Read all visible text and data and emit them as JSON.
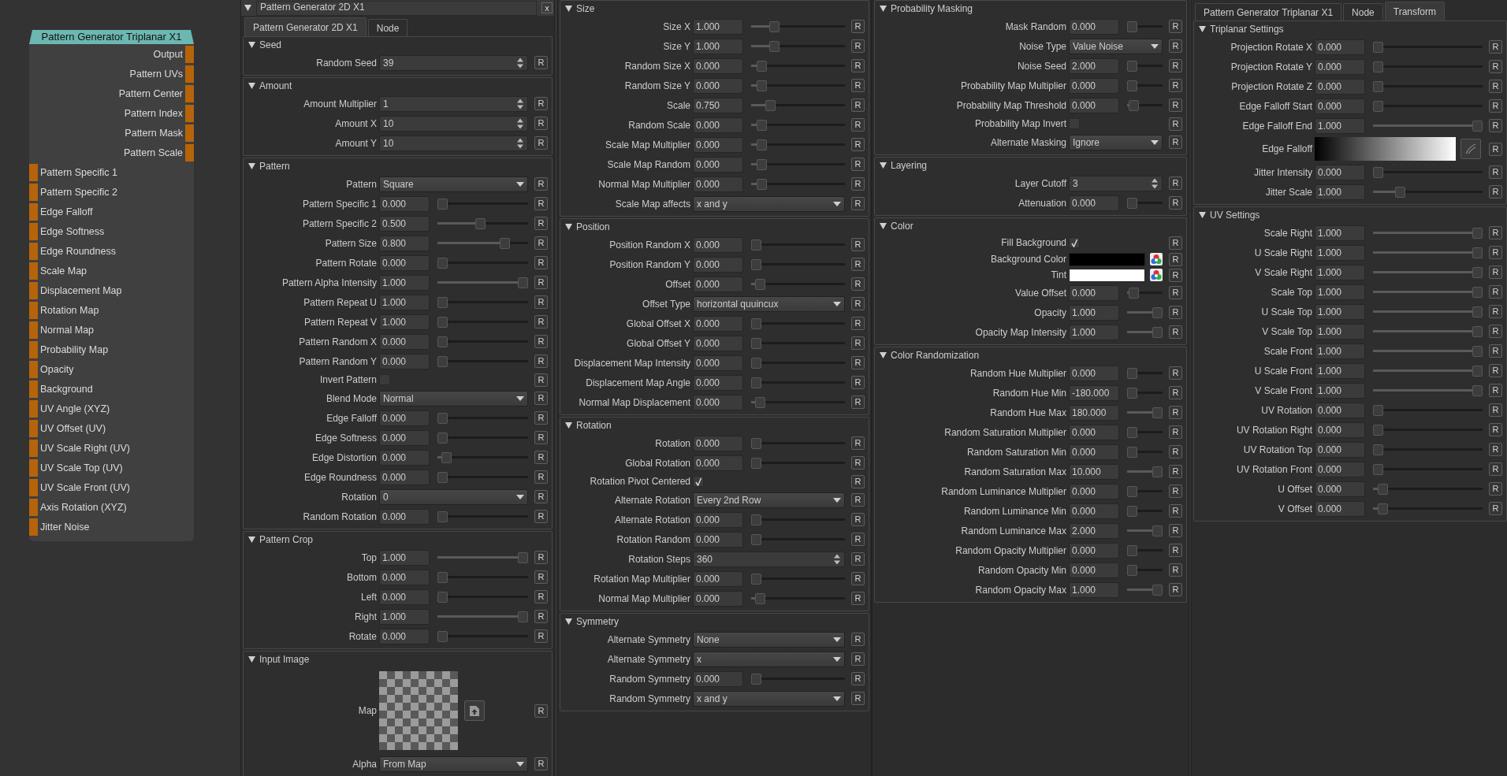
{
  "node": {
    "title": "Pattern Generator Triplanar X1",
    "outputs": [
      "Output",
      "Pattern UVs",
      "Pattern Center",
      "Pattern Index",
      "Pattern Mask",
      "Pattern Scale"
    ],
    "inputs": [
      "Pattern Specific 1",
      "Pattern Specific 2",
      "Edge Falloff",
      "Edge Softness",
      "Edge Roundness",
      "Scale Map",
      "Displacement Map",
      "Rotation Map",
      "Normal Map",
      "Probability Map",
      "Opacity",
      "Background",
      "UV Angle (XYZ)",
      "UV Offset (UV)",
      "UV Scale Right (UV)",
      "UV Scale Top (UV)",
      "UV Scale Front (UV)",
      "Axis Rotation (XYZ)",
      "Jitter Noise"
    ]
  },
  "panels": [
    {
      "header": {
        "title": "Pattern Generator 2D X1",
        "close": "x"
      },
      "tabs": [
        {
          "label": "Pattern Generator 2D X1",
          "selected": true
        },
        {
          "label": "Node",
          "selected": false
        }
      ],
      "sections": [
        {
          "title": "Seed",
          "rows": [
            {
              "kind": "spin",
              "label": "Random Seed",
              "value": "39",
              "reset": "R"
            }
          ]
        },
        {
          "title": "Amount",
          "rows": [
            {
              "kind": "spin",
              "label": "Amount Multiplier",
              "value": "1",
              "reset": "R"
            },
            {
              "kind": "spin",
              "label": "Amount X",
              "value": "10",
              "reset": "R"
            },
            {
              "kind": "spin",
              "label": "Amount Y",
              "value": "10",
              "reset": "R"
            }
          ]
        },
        {
          "title": "Pattern",
          "rows": [
            {
              "kind": "dropdown",
              "label": "Pattern",
              "value": "Square",
              "reset": "R"
            },
            {
              "kind": "slider",
              "label": "Pattern Specific 1",
              "value": "0.000",
              "level": 0,
              "reset": "R"
            },
            {
              "kind": "slider",
              "label": "Pattern Specific 2",
              "value": "0.500",
              "level": 0.47,
              "reset": "R"
            },
            {
              "kind": "slider",
              "label": "Pattern Size",
              "value": "0.800",
              "level": 0.77,
              "reset": "R"
            },
            {
              "kind": "slider",
              "label": "Pattern Rotate",
              "value": "0.000",
              "level": 0,
              "reset": "R"
            },
            {
              "kind": "slider",
              "label": "Pattern Alpha Intensity",
              "value": "1.000",
              "level": 1,
              "reset": "R"
            },
            {
              "kind": "slider",
              "label": "Pattern Repeat U",
              "value": "1.000",
              "level": 0,
              "reset": "R"
            },
            {
              "kind": "slider",
              "label": "Pattern Repeat V",
              "value": "1.000",
              "level": 0,
              "reset": "R"
            },
            {
              "kind": "slider",
              "label": "Pattern Random X",
              "value": "0.000",
              "level": 0,
              "reset": "R"
            },
            {
              "kind": "slider",
              "label": "Pattern Random Y",
              "value": "0.000",
              "level": 0,
              "reset": "R"
            },
            {
              "kind": "checkbox",
              "label": "Invert Pattern",
              "checked": false,
              "reset": "R"
            },
            {
              "kind": "dropdown",
              "label": "Blend Mode",
              "value": "Normal",
              "reset": "R"
            },
            {
              "kind": "slider",
              "label": "Edge Falloff",
              "value": "0.000",
              "level": 0,
              "reset": "R"
            },
            {
              "kind": "slider",
              "label": "Edge Softness",
              "value": "0.000",
              "level": 0,
              "reset": "R"
            },
            {
              "kind": "slider",
              "label": "Edge Distortion",
              "value": "0.000",
              "level": 0.05,
              "reset": "R"
            },
            {
              "kind": "slider",
              "label": "Edge Roundness",
              "value": "0.000",
              "level": 0,
              "reset": "R"
            },
            {
              "kind": "dropdown",
              "label": "Rotation",
              "value": "0",
              "reset": "R"
            },
            {
              "kind": "slider",
              "label": "Random Rotation",
              "value": "0.000",
              "level": 0,
              "reset": "R"
            }
          ]
        },
        {
          "title": "Pattern Crop",
          "rows": [
            {
              "kind": "slider",
              "label": "Top",
              "value": "1.000",
              "level": 1,
              "reset": "R"
            },
            {
              "kind": "slider",
              "label": "Bottom",
              "value": "0.000",
              "level": 0,
              "reset": "R"
            },
            {
              "kind": "slider",
              "label": "Left",
              "value": "0.000",
              "level": 0,
              "reset": "R"
            },
            {
              "kind": "slider",
              "label": "Right",
              "value": "1.000",
              "level": 1,
              "reset": "R"
            },
            {
              "kind": "slider",
              "label": "Rotate",
              "value": "0.000",
              "level": 0,
              "reset": "R"
            }
          ]
        },
        {
          "title": "Input Image",
          "rows": [
            {
              "kind": "image",
              "label": "Map",
              "reset": "R"
            },
            {
              "kind": "dropdown",
              "label": "Alpha",
              "value": "From Map",
              "reset": "R"
            }
          ]
        }
      ]
    },
    {
      "sections": [
        {
          "title": "Size",
          "rows": [
            {
              "kind": "slider",
              "label": "Size X",
              "value": "1.000",
              "level": 0.22,
              "reset": "R"
            },
            {
              "kind": "slider",
              "label": "Size Y",
              "value": "1.000",
              "level": 0.22,
              "reset": "R"
            },
            {
              "kind": "slider",
              "label": "Random Size X",
              "value": "0.000",
              "level": 0.07,
              "reset": "R"
            },
            {
              "kind": "slider",
              "label": "Random Size Y",
              "value": "0.000",
              "level": 0.07,
              "reset": "R"
            },
            {
              "kind": "slider",
              "label": "Scale",
              "value": "0.750",
              "level": 0.17,
              "reset": "R"
            },
            {
              "kind": "slider",
              "label": "Random Scale",
              "value": "0.000",
              "level": 0.07,
              "reset": "R"
            },
            {
              "kind": "slider",
              "label": "Scale Map Multiplier",
              "value": "0.000",
              "level": 0.07,
              "reset": "R"
            },
            {
              "kind": "slider",
              "label": "Scale Map Random",
              "value": "0.000",
              "level": 0.07,
              "reset": "R"
            },
            {
              "kind": "slider",
              "label": "Normal Map Multiplier",
              "value": "0.000",
              "level": 0.07,
              "reset": "R"
            },
            {
              "kind": "dropdown",
              "label": "Scale Map affects",
              "value": "x and y",
              "reset": "R"
            }
          ]
        },
        {
          "title": "Position",
          "rows": [
            {
              "kind": "slider",
              "label": "Position Random X",
              "value": "0.000",
              "level": 0,
              "reset": "R"
            },
            {
              "kind": "slider",
              "label": "Position Random Y",
              "value": "0.000",
              "level": 0,
              "reset": "R"
            },
            {
              "kind": "slider",
              "label": "Offset",
              "value": "0.000",
              "level": 0.05,
              "reset": "R"
            },
            {
              "kind": "dropdown",
              "label": "Offset Type",
              "value": "horizontal quuincux",
              "reset": "R"
            },
            {
              "kind": "slider",
              "label": "Global Offset X",
              "value": "0.000",
              "level": 0,
              "reset": "R"
            },
            {
              "kind": "slider",
              "label": "Global Offset Y",
              "value": "0.000",
              "level": 0,
              "reset": "R"
            },
            {
              "kind": "slider",
              "label": "Displacement Map Intensity",
              "value": "0.000",
              "level": 0,
              "reset": "R"
            },
            {
              "kind": "slider",
              "label": "Displacement Map Angle",
              "value": "0.000",
              "level": 0,
              "reset": "R"
            },
            {
              "kind": "slider",
              "label": "Normal Map Displacement",
              "value": "0.000",
              "level": 0.05,
              "reset": "R"
            }
          ]
        },
        {
          "title": "Rotation",
          "rows": [
            {
              "kind": "slider",
              "label": "Rotation",
              "value": "0.000",
              "level": 0,
              "reset": "R"
            },
            {
              "kind": "slider",
              "label": "Global Rotation",
              "value": "0.000",
              "level": 0,
              "reset": "R"
            },
            {
              "kind": "checkbox",
              "label": "Rotation Pivot Centered",
              "checked": true,
              "reset": "R"
            },
            {
              "kind": "dropdown",
              "label": "Alternate Rotation",
              "value": "Every 2nd Row",
              "reset": "R"
            },
            {
              "kind": "slider",
              "label": "Alternate Rotation",
              "value": "0.000",
              "level": 0,
              "reset": "R"
            },
            {
              "kind": "slider",
              "label": "Rotation Random",
              "value": "0.000",
              "level": 0,
              "reset": "R"
            },
            {
              "kind": "spin",
              "label": "Rotation Steps",
              "value": "360",
              "reset": "R"
            },
            {
              "kind": "slider",
              "label": "Rotation Map Multiplier",
              "value": "0.000",
              "level": 0,
              "reset": "R"
            },
            {
              "kind": "slider",
              "label": "Normal Map Multiplier",
              "value": "0.000",
              "level": 0.05,
              "reset": "R"
            }
          ]
        },
        {
          "title": "Symmetry",
          "rows": [
            {
              "kind": "dropdown",
              "label": "Alternate Symmetry",
              "value": "None",
              "reset": "R"
            },
            {
              "kind": "dropdown",
              "label": "Alternate Symmetry",
              "value": "x",
              "reset": "R"
            },
            {
              "kind": "slider",
              "label": "Random Symmetry",
              "value": "0.000",
              "level": 0,
              "reset": "R"
            },
            {
              "kind": "dropdown",
              "label": "Random Symmetry",
              "value": "x and y",
              "reset": "R"
            }
          ]
        }
      ]
    },
    {
      "sections": [
        {
          "title": "Probability Masking",
          "rows": [
            {
              "kind": "slider",
              "label": "Mask Random",
              "value": "0.000",
              "level": 0,
              "reset": "R"
            },
            {
              "kind": "dropdown",
              "label": "Noise Type",
              "value": "Value Noise",
              "reset": "R"
            },
            {
              "kind": "slider",
              "label": "Noise Seed",
              "value": "2.000",
              "level": 0,
              "reset": "R"
            },
            {
              "kind": "slider",
              "label": "Probability Map Multiplier",
              "value": "0.000",
              "level": 0,
              "reset": "R"
            },
            {
              "kind": "slider",
              "label": "Probability Map Threshold",
              "value": "0.000",
              "level": 0.05,
              "reset": "R"
            },
            {
              "kind": "checkbox",
              "label": "Probability Map Invert",
              "checked": false,
              "reset": "R"
            },
            {
              "kind": "dropdown",
              "label": "Alternate Masking",
              "value": "Ignore",
              "reset": "R"
            }
          ]
        },
        {
          "title": "Layering",
          "rows": [
            {
              "kind": "spin",
              "label": "Layer Cutoff",
              "value": "3",
              "reset": "R"
            },
            {
              "kind": "slider",
              "label": "Attenuation",
              "value": "0.000",
              "level": 0,
              "reset": "R"
            }
          ]
        },
        {
          "title": "Color",
          "rows": [
            {
              "kind": "checkbox",
              "label": "Fill Background",
              "checked": true,
              "reset": "R"
            },
            {
              "kind": "color",
              "label": "Background Color",
              "color": "#000000",
              "reset": "R"
            },
            {
              "kind": "color",
              "label": "Tint",
              "color": "#ffffff",
              "reset": "R"
            },
            {
              "kind": "slider",
              "label": "Value Offset",
              "value": "0.000",
              "level": 0.05,
              "reset": "R"
            },
            {
              "kind": "slider",
              "label": "Opacity",
              "value": "1.000",
              "level": 1,
              "reset": "R"
            },
            {
              "kind": "slider",
              "label": "Opacity Map Intensity",
              "value": "1.000",
              "level": 1,
              "reset": "R"
            }
          ]
        },
        {
          "title": "Color Randomization",
          "rows": [
            {
              "kind": "slider",
              "label": "Random Hue Multiplier",
              "value": "0.000",
              "level": 0,
              "reset": "R"
            },
            {
              "kind": "slider",
              "label": "Random Hue Min",
              "value": "-180.000",
              "level": 0,
              "reset": "R"
            },
            {
              "kind": "slider",
              "label": "Random Hue Max",
              "value": "180.000",
              "level": 1,
              "reset": "R"
            },
            {
              "kind": "slider",
              "label": "Random Saturation Multiplier",
              "value": "0.000",
              "level": 0,
              "reset": "R"
            },
            {
              "kind": "slider",
              "label": "Random Saturation Min",
              "value": "0.000",
              "level": 0,
              "reset": "R"
            },
            {
              "kind": "slider",
              "label": "Random Saturation Max",
              "value": "10.000",
              "level": 1,
              "reset": "R"
            },
            {
              "kind": "slider",
              "label": "Random Luminance Multiplier",
              "value": "0.000",
              "level": 0,
              "reset": "R"
            },
            {
              "kind": "slider",
              "label": "Random Luminance Min",
              "value": "0.000",
              "level": 0,
              "reset": "R"
            },
            {
              "kind": "slider",
              "label": "Random Luminance Max",
              "value": "2.000",
              "level": 1,
              "reset": "R"
            },
            {
              "kind": "slider",
              "label": "Random Opacity Multiplier",
              "value": "0.000",
              "level": 0,
              "reset": "R"
            },
            {
              "kind": "slider",
              "label": "Random Opacity Min",
              "value": "0.000",
              "level": 0,
              "reset": "R"
            },
            {
              "kind": "slider",
              "label": "Random Opacity Max",
              "value": "1.000",
              "level": 1,
              "reset": "R"
            }
          ]
        }
      ]
    },
    {
      "tabs": [
        {
          "label": "Pattern Generator Triplanar X1",
          "selected": false
        },
        {
          "label": "Node",
          "selected": false
        },
        {
          "label": "Transform",
          "selected": true
        }
      ],
      "sections": [
        {
          "title": "Triplanar Settings",
          "rows": [
            {
              "kind": "slider",
              "label": "Projection Rotate X",
              "value": "0.000",
              "level": 0,
              "reset": "R"
            },
            {
              "kind": "slider",
              "label": "Projection Rotate Y",
              "value": "0.000",
              "level": 0,
              "reset": "R"
            },
            {
              "kind": "slider",
              "label": "Projection Rotate Z",
              "value": "0.000",
              "level": 0,
              "reset": "R"
            },
            {
              "kind": "slider",
              "label": "Edge Falloff Start",
              "value": "0.000",
              "level": 0,
              "reset": "R"
            },
            {
              "kind": "slider",
              "label": "Edge Falloff End",
              "value": "1.000",
              "level": 1,
              "reset": "R"
            },
            {
              "kind": "gradient",
              "label": "Edge Falloff",
              "reset": "R"
            },
            {
              "kind": "slider",
              "label": "Jitter Intensity",
              "value": "0.000",
              "level": 0,
              "reset": "R"
            },
            {
              "kind": "slider",
              "label": "Jitter Scale",
              "value": "1.000",
              "level": 0.22,
              "reset": "R"
            }
          ]
        },
        {
          "title": "UV Settings",
          "rows": [
            {
              "kind": "slider",
              "label": "Scale Right",
              "value": "1.000",
              "level": 1,
              "reset": "R"
            },
            {
              "kind": "slider",
              "label": "U Scale Right",
              "value": "1.000",
              "level": 1,
              "reset": "R"
            },
            {
              "kind": "slider",
              "label": "V Scale Right",
              "value": "1.000",
              "level": 1,
              "reset": "R"
            },
            {
              "kind": "slider",
              "label": "Scale Top",
              "value": "1.000",
              "level": 1,
              "reset": "R"
            },
            {
              "kind": "slider",
              "label": "U Scale Top",
              "value": "1.000",
              "level": 1,
              "reset": "R"
            },
            {
              "kind": "slider",
              "label": "V Scale Top",
              "value": "1.000",
              "level": 1,
              "reset": "R"
            },
            {
              "kind": "slider",
              "label": "Scale Front",
              "value": "1.000",
              "level": 1,
              "reset": "R"
            },
            {
              "kind": "slider",
              "label": "U Scale Front",
              "value": "1.000",
              "level": 1,
              "reset": "R"
            },
            {
              "kind": "slider",
              "label": "V Scale Front",
              "value": "1.000",
              "level": 1,
              "reset": "R"
            },
            {
              "kind": "slider",
              "label": "UV Rotation",
              "value": "0.000",
              "level": 0,
              "reset": "R"
            },
            {
              "kind": "slider",
              "label": "UV Rotation Right",
              "value": "0.000",
              "level": 0,
              "reset": "R"
            },
            {
              "kind": "slider",
              "label": "UV Rotation Top",
              "value": "0.000",
              "level": 0,
              "reset": "R"
            },
            {
              "kind": "slider",
              "label": "UV Rotation Front",
              "value": "0.000",
              "level": 0,
              "reset": "R"
            },
            {
              "kind": "slider",
              "label": "U Offset",
              "value": "0.000",
              "level": 0.05,
              "reset": "R"
            },
            {
              "kind": "slider",
              "label": "V Offset",
              "value": "0.000",
              "level": 0.05,
              "reset": "R"
            }
          ]
        }
      ]
    }
  ]
}
